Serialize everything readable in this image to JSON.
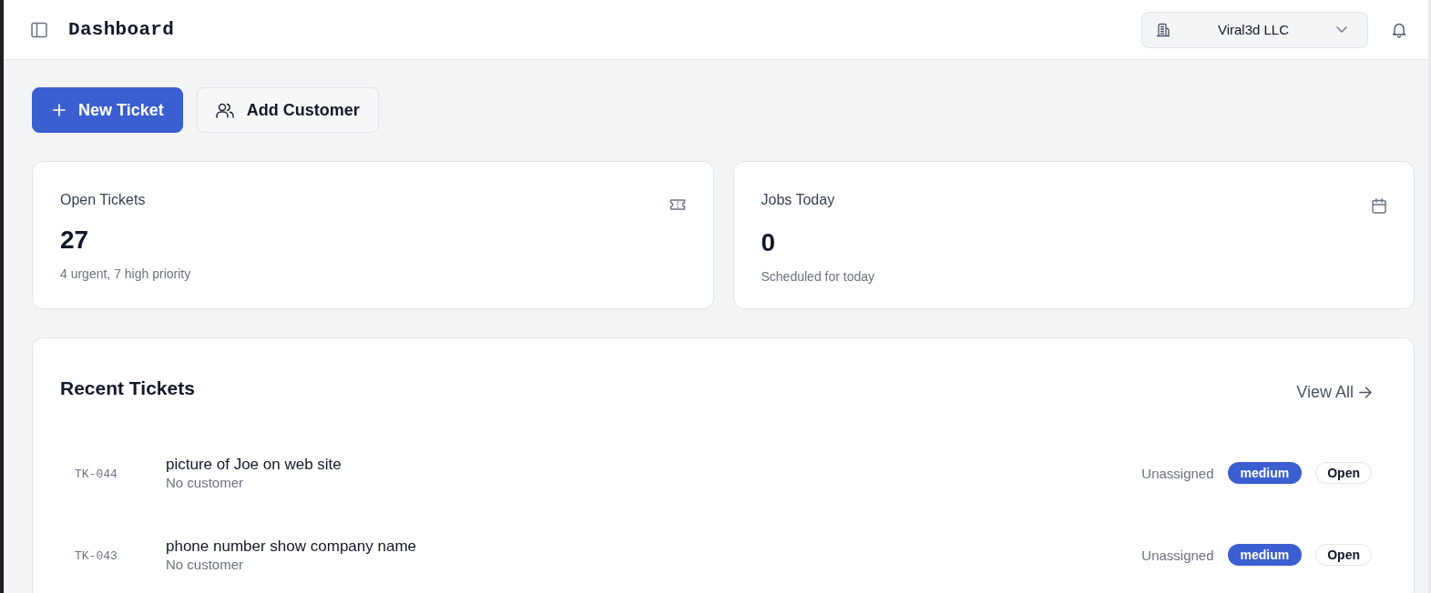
{
  "header": {
    "title": "Dashboard",
    "organization": "Viral3d LLC"
  },
  "actions": [
    {
      "label": "New Ticket",
      "kind": "primary"
    },
    {
      "label": "Add Customer",
      "kind": "secondary"
    }
  ],
  "stats": [
    {
      "title": "Open Tickets",
      "value": "27",
      "subtitle": "4 urgent, 7 high priority",
      "kind": "ticket"
    },
    {
      "title": "Jobs Today",
      "value": "0",
      "subtitle": "Scheduled for today",
      "kind": "calendar"
    }
  ],
  "recent_tickets": {
    "title": "Recent Tickets",
    "view_all": "View All",
    "rows": [
      {
        "id": "TK-044",
        "title": "picture of Joe on web site",
        "customer": "No customer",
        "assignee": "Unassigned",
        "priority": "medium",
        "status": "Open"
      },
      {
        "id": "TK-043",
        "title": "phone number show company name",
        "customer": "No customer",
        "assignee": "Unassigned",
        "priority": "medium",
        "status": "Open"
      }
    ]
  }
}
